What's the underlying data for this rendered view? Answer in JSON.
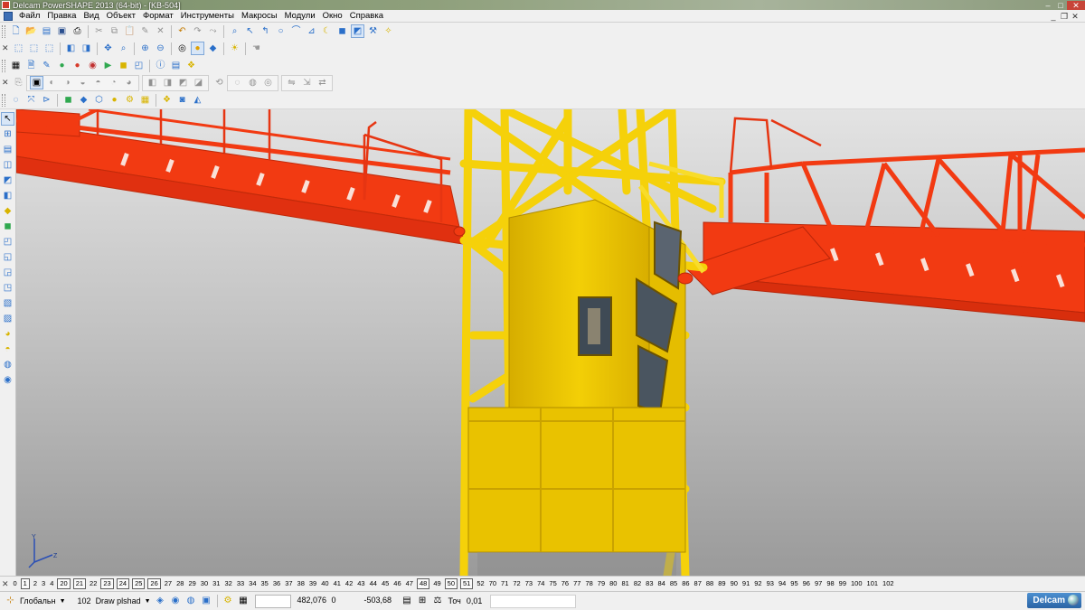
{
  "titlebar": {
    "title": "Delcam PowerSHAPE 2013 (64-bit) - [KB-504]",
    "icon": "powershape-app-icon",
    "buttons": [
      "minimize",
      "maximize",
      "close"
    ]
  },
  "menu": {
    "items": [
      "Файл",
      "Правка",
      "Вид",
      "Объект",
      "Формат",
      "Инструменты",
      "Макросы",
      "Модули",
      "Окно",
      "Справка"
    ]
  },
  "layerbar": {
    "layers": [
      "0",
      "1",
      "2",
      "3",
      "4",
      "20",
      "21",
      "22",
      "23",
      "24",
      "25",
      "26",
      "27",
      "28",
      "29",
      "30",
      "31",
      "32",
      "33",
      "34",
      "35",
      "36",
      "37",
      "38",
      "39",
      "40",
      "41",
      "42",
      "43",
      "44",
      "45",
      "46",
      "47",
      "48",
      "49",
      "50",
      "51",
      "52",
      "70",
      "71",
      "72",
      "73",
      "74",
      "75",
      "76",
      "77",
      "78",
      "79",
      "80",
      "81",
      "82",
      "83",
      "84",
      "85",
      "86",
      "87",
      "88",
      "89",
      "90",
      "91",
      "92",
      "93",
      "94",
      "95",
      "96",
      "97",
      "98",
      "99",
      "100",
      "101",
      "102"
    ],
    "boxed": [
      "1",
      "20",
      "21",
      "23",
      "24",
      "25",
      "26",
      "48",
      "50",
      "51"
    ]
  },
  "status": {
    "workplane": "Глобальн",
    "layer_number": "102",
    "layer_name": "Draw plshad",
    "x": "482,076",
    "y": "0",
    "z": "-503,68",
    "tolerance_label": "Точ",
    "tolerance_value": "0,01"
  },
  "brand": {
    "name": "Delcam"
  },
  "axis": {
    "y_label": "Y",
    "z_label": "Z"
  },
  "colors": {
    "boom_red": "#f23a12",
    "tower_yellow": "#f5d10a",
    "cabin_yellow": "#f2cc00"
  }
}
